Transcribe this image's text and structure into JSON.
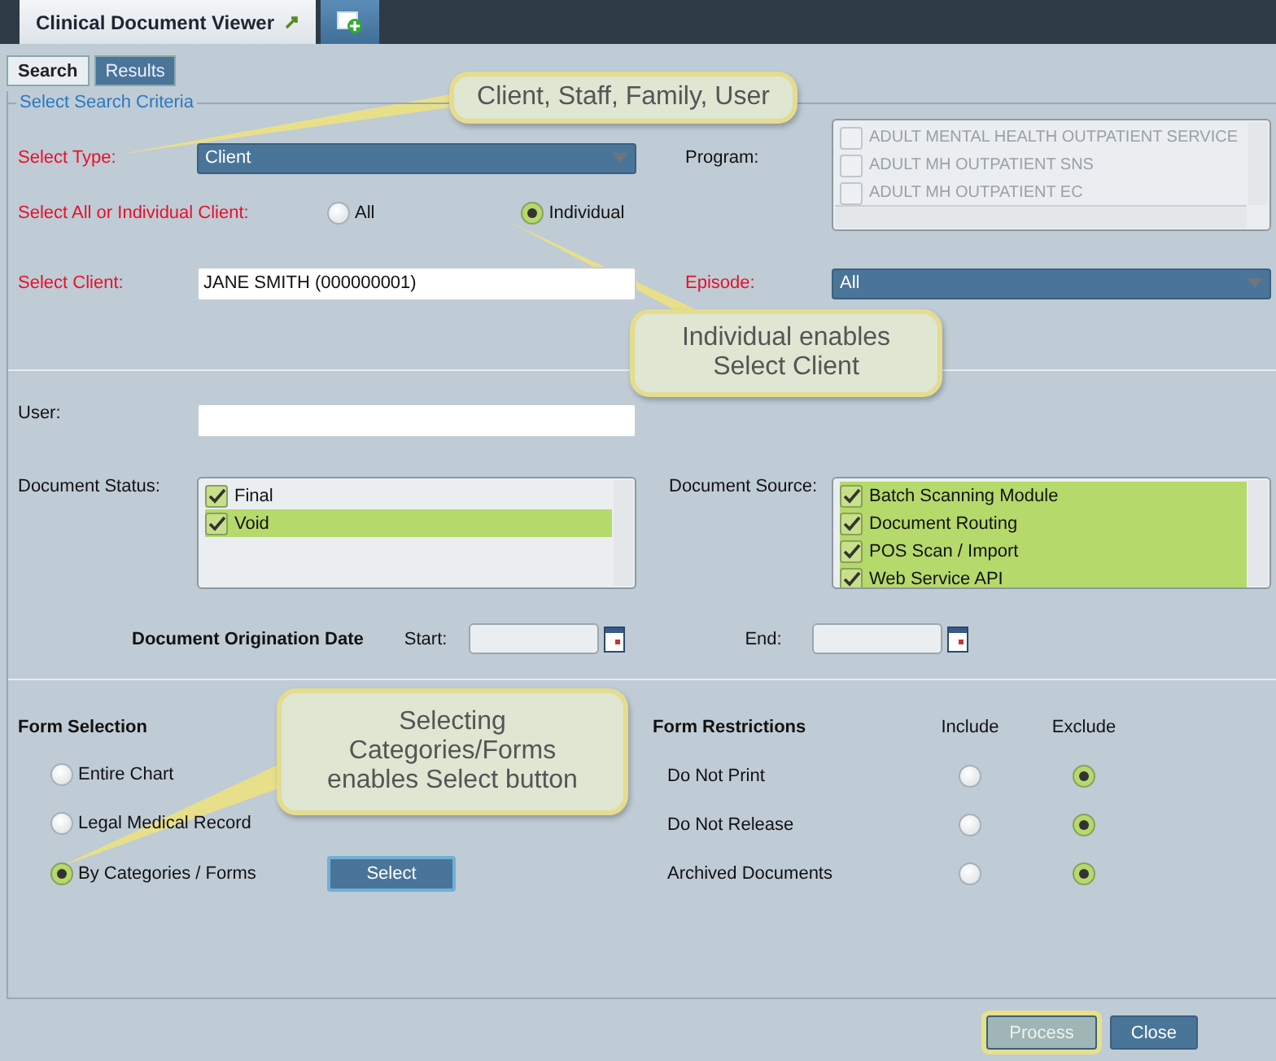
{
  "window_tabs": [
    {
      "kind": "document",
      "label": "Clinical Document Viewer",
      "selected": true
    },
    {
      "kind": "new",
      "selected": false
    }
  ],
  "sub_tabs": [
    {
      "label": "Search",
      "selected": true
    },
    {
      "label": "Results",
      "selected": false
    }
  ],
  "criteria": {
    "legend": "Select Search Criteria",
    "select_type": {
      "label": "Select Type:",
      "required": true,
      "value": "Client"
    },
    "client_scope": {
      "label": "Select All or Individual Client:",
      "required": true,
      "options": [
        {
          "label": "All",
          "selected": false
        },
        {
          "label": "Individual",
          "selected": true
        }
      ]
    },
    "select_client": {
      "label": "Select Client:",
      "required": true,
      "value": "JANE SMITH (000000001)"
    },
    "program": {
      "label": "Program:",
      "disabled": true,
      "items": [
        {
          "label": "ADULT MENTAL HEALTH OUTPATIENT SERVICE",
          "checked": false
        },
        {
          "label": "ADULT MH OUTPATIENT SNS",
          "checked": false
        },
        {
          "label": "ADULT MH OUTPATIENT EC",
          "checked": false
        }
      ]
    },
    "episode": {
      "label": "Episode:",
      "required": true,
      "value": "All"
    },
    "user": {
      "label": "User:",
      "required": false
    },
    "document_status": {
      "label": "Document Status:",
      "items": [
        {
          "label": "Final",
          "checked": true,
          "selected": false
        },
        {
          "label": "Void",
          "checked": true,
          "selected": true
        }
      ]
    },
    "document_source": {
      "label": "Document Source:",
      "items": [
        {
          "label": "Batch Scanning Module",
          "checked": true,
          "selected": true
        },
        {
          "label": "Document Routing",
          "checked": true,
          "selected": true
        },
        {
          "label": "POS Scan / Import",
          "checked": true,
          "selected": true
        },
        {
          "label": "Web Service API",
          "checked": true,
          "selected": true
        }
      ]
    },
    "origination_date": {
      "label": "Document Origination Date",
      "start_label": "Start:",
      "end_label": "End:"
    }
  },
  "form_selection": {
    "title": "Form Selection",
    "options": [
      {
        "label": "Entire Chart",
        "selected": false
      },
      {
        "label": "Legal Medical Record",
        "selected": false
      },
      {
        "label": "By Categories / Forms",
        "selected": true
      }
    ],
    "select_button": "Select"
  },
  "form_restrictions": {
    "title": "Form Restrictions",
    "columns": [
      "Include",
      "Exclude"
    ],
    "rows": [
      {
        "label": "Do Not Print",
        "options": [
          {
            "selected": false
          },
          {
            "selected": true
          }
        ]
      },
      {
        "label": "Do Not Release",
        "options": [
          {
            "selected": false
          },
          {
            "selected": true
          }
        ]
      },
      {
        "label": "Archived Documents",
        "options": [
          {
            "selected": false
          },
          {
            "selected": true
          }
        ]
      }
    ]
  },
  "buttons": [
    {
      "label": "Process",
      "highlighted": true
    },
    {
      "label": "Close",
      "highlighted": false
    }
  ],
  "callouts": [
    {
      "text": "Client, Staff, Family, User"
    },
    {
      "text": "Individual enables Select Client"
    },
    {
      "text": "Selecting Categories/Forms enables Select button"
    }
  ]
}
